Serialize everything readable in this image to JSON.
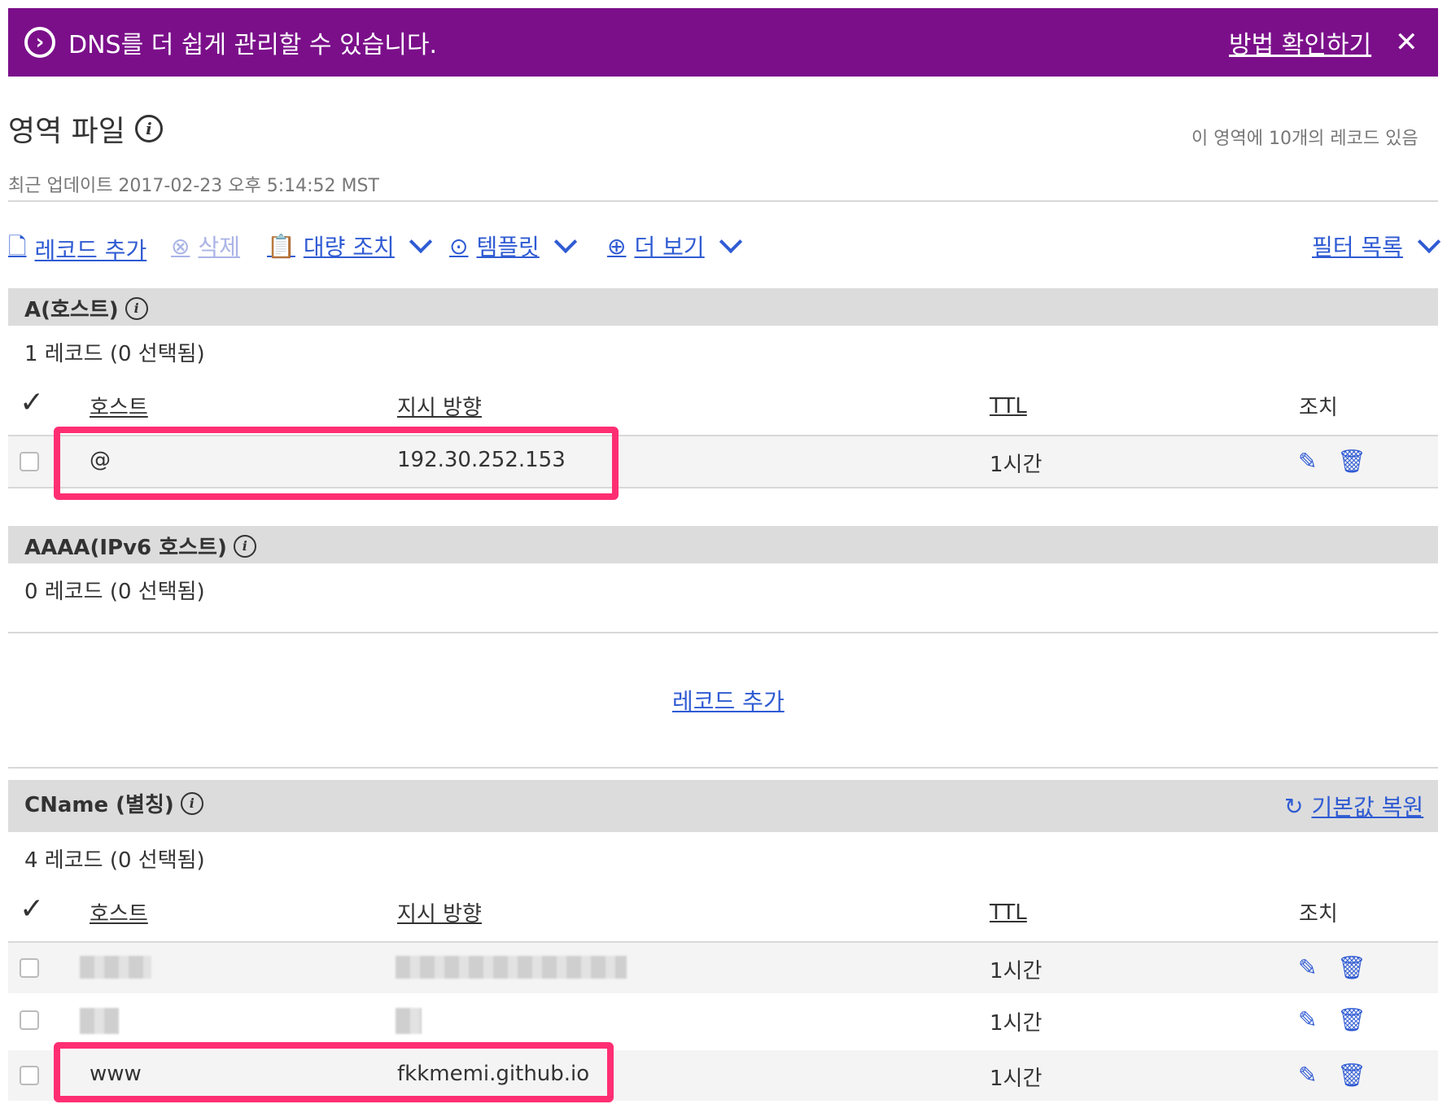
{
  "banner": {
    "message": "DNS를 더 쉽게 관리할 수 있습니다.",
    "link": "방법 확인하기",
    "close": "✕"
  },
  "header": {
    "title": "영역 파일",
    "record_count": "이 영역에 10개의 레코드 있음",
    "updated": "최근 업데이트 2017-02-23 오후 5:14:52 MST"
  },
  "toolbar": {
    "add_record": "레코드 추가",
    "delete": "삭제",
    "bulk": "대량 조치",
    "template": "템플릿",
    "more": "더 보기",
    "filter": "필터 목록"
  },
  "columns": {
    "host": "호스트",
    "points_to": "지시 방향",
    "ttl": "TTL",
    "actions": "조치"
  },
  "sections": {
    "a": {
      "title": "A(호스트)",
      "count": "1 레코드 (0 선택됨)",
      "rows": [
        {
          "host": "@",
          "points_to": "192.30.252.153",
          "ttl": "1시간"
        }
      ]
    },
    "aaaa": {
      "title": "AAAA(IPv6 호스트)",
      "count": "0 레코드 (0 선택됨)",
      "add_link": "레코드 추가"
    },
    "cname": {
      "title": "CName (별칭)",
      "count": "4 레코드 (0 선택됨)",
      "restore": "기본값 복원",
      "rows": [
        {
          "host": "",
          "points_to": "",
          "ttl": "1시간"
        },
        {
          "host": "",
          "points_to": "",
          "ttl": "1시간"
        },
        {
          "host": "www",
          "points_to": "fkkmemi.github.io",
          "ttl": "1시간"
        }
      ]
    }
  },
  "colors": {
    "banner": "#7b0f8a",
    "link": "#2f5bd3",
    "highlight": "#ff2e73",
    "section_header": "#dcdcdc"
  },
  "icons": [
    "arrow-right-circle-icon",
    "close-icon",
    "info-icon",
    "new-document-icon",
    "delete-circle-icon",
    "clipboard-edit-icon",
    "template-icon",
    "plus-circle-icon",
    "chevron-down-icon",
    "checkmark-icon",
    "edit-icon",
    "trash-icon",
    "restore-icon"
  ]
}
